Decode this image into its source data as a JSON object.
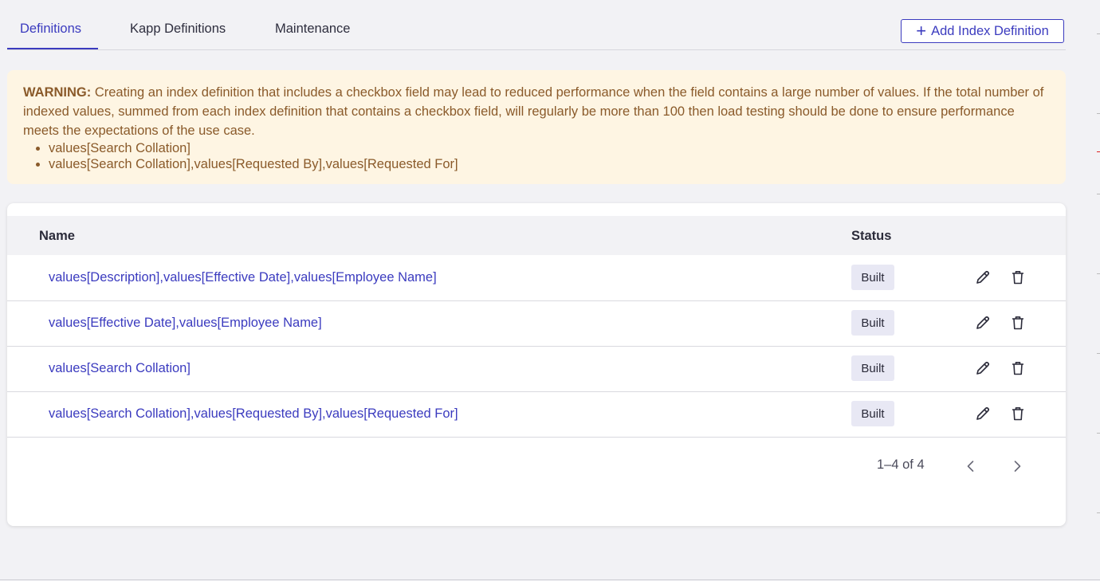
{
  "tabs": {
    "definitions": "Definitions",
    "kapp_definitions": "Kapp Definitions",
    "maintenance": "Maintenance"
  },
  "add_button": {
    "icon": "plus-icon",
    "label": "Add Index Definition"
  },
  "warning": {
    "label": "WARNING:",
    "text": "Creating an index definition that includes a checkbox field may lead to reduced performance when the field contains a large number of values. If the total number of indexed values, summed from each index definition that contains a checkbox field, will regularly be more than 100 then load testing should be done to ensure performance meets the expectations of the use case.",
    "items": [
      "values[Search Collation]",
      "values[Search Collation],values[Requested By],values[Requested For]"
    ]
  },
  "table": {
    "columns": {
      "name": "Name",
      "status": "Status"
    },
    "rows": [
      {
        "name": "values[Description],values[Effective Date],values[Employee Name]",
        "status": "Built"
      },
      {
        "name": "values[Effective Date],values[Employee Name]",
        "status": "Built"
      },
      {
        "name": "values[Search Collation]",
        "status": "Built"
      },
      {
        "name": "values[Search Collation],values[Requested By],values[Requested For]",
        "status": "Built"
      }
    ],
    "row_icons": {
      "edit": "pencil-icon",
      "delete": "trash-icon"
    }
  },
  "pagination": {
    "summary": "1–4 of 4",
    "prev_icon": "chevron-left-icon",
    "next_icon": "chevron-right-icon"
  },
  "colors": {
    "accent": "#3b3bbf",
    "warning_bg": "#fef5e3",
    "warning_text": "#8a5a2a",
    "badge_bg": "#e8e8f4"
  }
}
